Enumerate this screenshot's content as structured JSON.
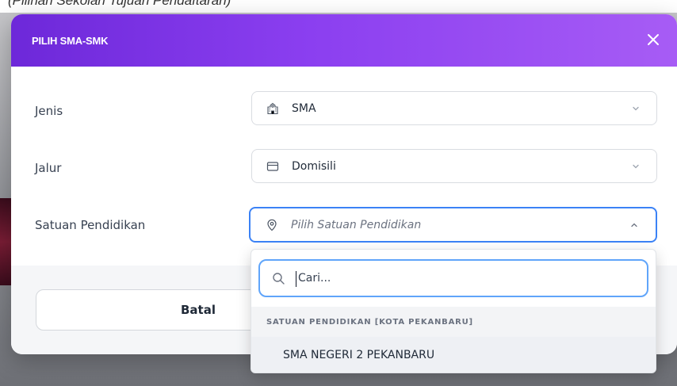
{
  "background": {
    "top_text": "(Pilihan Sekolah Tujuan Pendaftaran)"
  },
  "modal": {
    "title": "PILIH SMA-SMK",
    "close_icon": "close-icon",
    "header_gradient": [
      "#6d28d9",
      "#a75cf5"
    ]
  },
  "form": {
    "fields": [
      {
        "label": "Jenis",
        "value": "SMA",
        "icon": "school-building-icon"
      },
      {
        "label": "Jalur",
        "value": "Domisili",
        "icon": "card-icon"
      },
      {
        "label": "Satuan Pendidikan",
        "placeholder": "Pilih Satuan Pendidikan",
        "icon": "location-pin-icon",
        "expanded": true
      }
    ]
  },
  "footer": {
    "cancel_label": "Batal"
  },
  "dropdown": {
    "search_placeholder": "Cari...",
    "group_label": "SATUAN PENDIDIKAN [KOTA PEKANBARU]",
    "options": [
      "SMA NEGERI 2 PEKANBARU"
    ]
  },
  "colors": {
    "accent": "#8b3ff0",
    "focus": "#3b82f6"
  }
}
